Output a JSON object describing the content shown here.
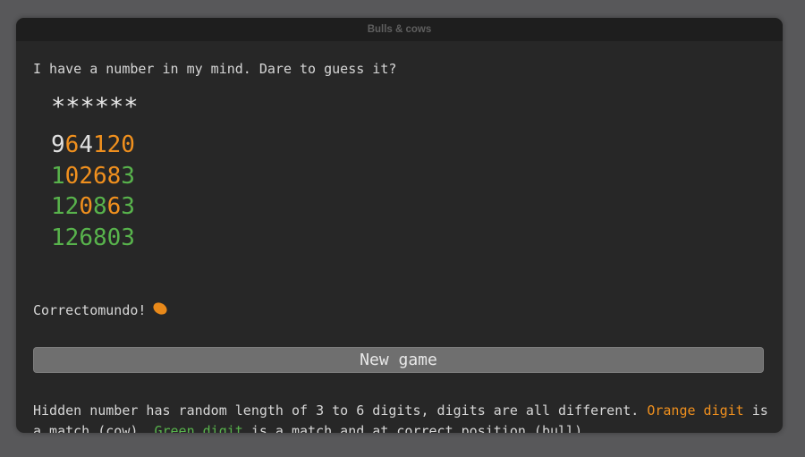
{
  "window": {
    "title": "Bulls & cows"
  },
  "game": {
    "intro": "I have a number in my mind. Dare to guess it?",
    "hidden_number_mask": "******",
    "guesses": [
      {
        "value": "964120",
        "digits": [
          {
            "d": "9",
            "status": "none"
          },
          {
            "d": "6",
            "status": "cow"
          },
          {
            "d": "4",
            "status": "none"
          },
          {
            "d": "1",
            "status": "cow"
          },
          {
            "d": "2",
            "status": "cow"
          },
          {
            "d": "0",
            "status": "cow"
          }
        ]
      },
      {
        "value": "102683",
        "digits": [
          {
            "d": "1",
            "status": "bull"
          },
          {
            "d": "0",
            "status": "cow"
          },
          {
            "d": "2",
            "status": "cow"
          },
          {
            "d": "6",
            "status": "cow"
          },
          {
            "d": "8",
            "status": "cow"
          },
          {
            "d": "3",
            "status": "bull"
          }
        ]
      },
      {
        "value": "120863",
        "digits": [
          {
            "d": "1",
            "status": "bull"
          },
          {
            "d": "2",
            "status": "bull"
          },
          {
            "d": "0",
            "status": "cow"
          },
          {
            "d": "8",
            "status": "bull"
          },
          {
            "d": "6",
            "status": "cow"
          },
          {
            "d": "3",
            "status": "bull"
          }
        ]
      },
      {
        "value": "126803",
        "digits": [
          {
            "d": "1",
            "status": "bull"
          },
          {
            "d": "2",
            "status": "bull"
          },
          {
            "d": "6",
            "status": "bull"
          },
          {
            "d": "8",
            "status": "bull"
          },
          {
            "d": "0",
            "status": "bull"
          },
          {
            "d": "3",
            "status": "bull"
          }
        ]
      }
    ],
    "status_message": "Correctomundo!",
    "status_icon": "clapping-hands-icon",
    "new_game_label": "New game"
  },
  "help": {
    "part1": "Hidden number has random length of 3 to 6 digits, digits are all different. ",
    "orange_label": "Orange digit",
    "part2": " is a match (cow). ",
    "green_label": "Green digit",
    "part3": " is a match and at correct position (bull)."
  },
  "colors": {
    "cow": "#f0901e",
    "bull": "#58b34c",
    "none": "#e0e0e0",
    "background": "#272727",
    "titlebar": "#1e1e1e",
    "button": "#6f6f6f"
  }
}
